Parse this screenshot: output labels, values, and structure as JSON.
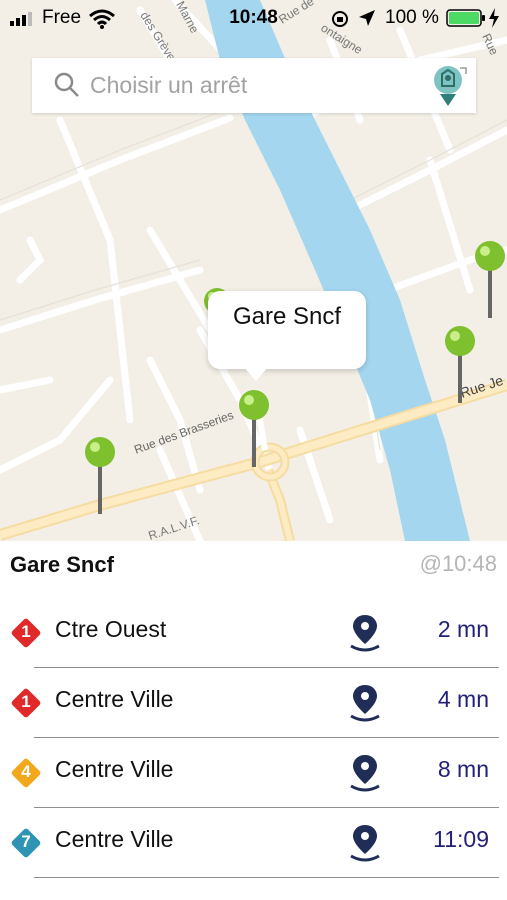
{
  "status_bar": {
    "carrier": "Free",
    "time": "10:48",
    "battery_percent": "100 %"
  },
  "search": {
    "placeholder": "Choisir un arrêt"
  },
  "map": {
    "streets": {
      "greves": "des Grèves",
      "marne": "Marne",
      "rue_de": "Rue de",
      "ontaigne": "ontaigne",
      "rue_right": "Rue",
      "brasseries": "Rue des Brasseries",
      "rue_je": "Rue Je",
      "alvf": "R.A.L.V.F."
    },
    "callout": "Gare Sncf"
  },
  "panel": {
    "stop_name": "Gare Sncf",
    "updated": "@10:48",
    "departures": [
      {
        "line": "1",
        "color": "#e02a2a",
        "destination": "Ctre Ouest",
        "eta": "2 mn"
      },
      {
        "line": "1",
        "color": "#e02a2a",
        "destination": "Centre Ville",
        "eta": "4 mn"
      },
      {
        "line": "4",
        "color": "#f2a81d",
        "destination": "Centre Ville",
        "eta": "8 mn"
      },
      {
        "line": "7",
        "color": "#2f93b3",
        "destination": "Centre Ville",
        "eta": "11:09"
      }
    ]
  }
}
